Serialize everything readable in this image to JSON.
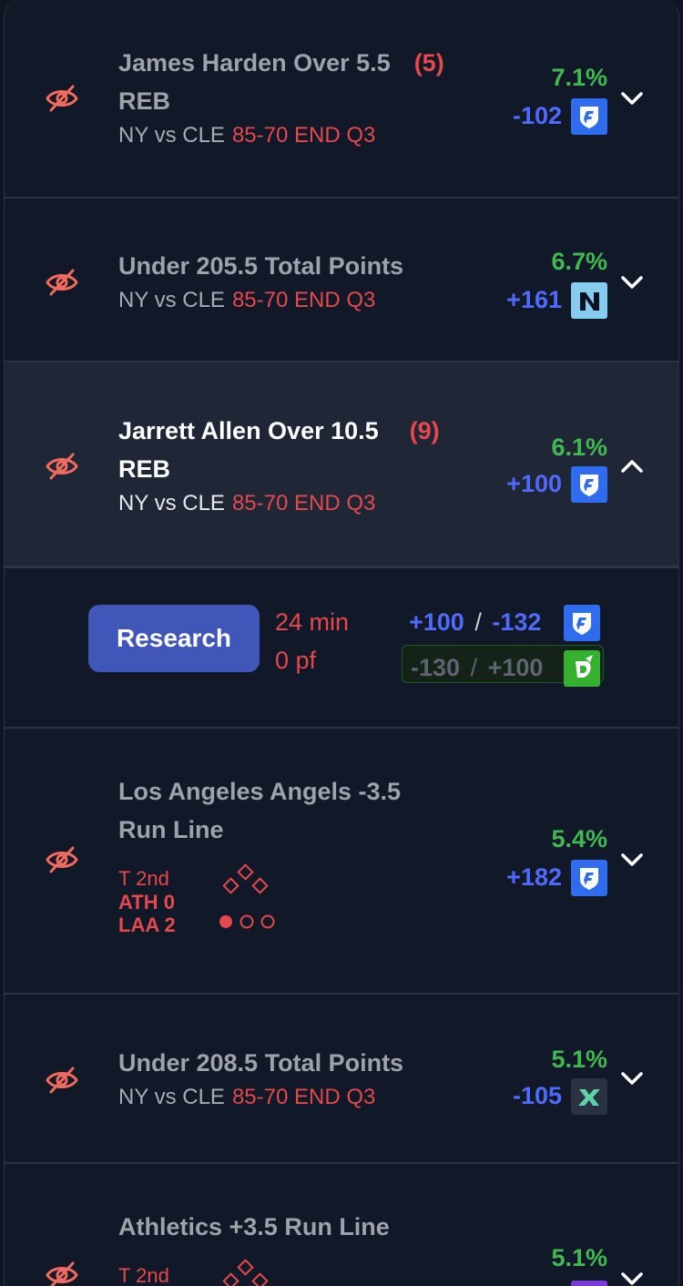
{
  "colors": {
    "green": "#3fb950",
    "blue": "#4f6bff",
    "red": "#e5484d",
    "button": "#4056b8"
  },
  "bets": [
    {
      "title": "James Harden Over 5.5",
      "title2": "REB",
      "count": "(5)",
      "teams": "NY vs CLE",
      "score": "85-70 END Q3",
      "pct": "7.1%",
      "odds": "-102",
      "book_icon": "fanduel-icon"
    },
    {
      "title": "Under 205.5 Total Points",
      "teams": "NY vs CLE",
      "score": "85-70 END Q3",
      "pct": "6.7%",
      "odds": "+161",
      "book_icon": "novig-icon"
    },
    {
      "title": "Jarrett Allen Over 10.5",
      "title2": "REB",
      "count": "(9)",
      "teams": "NY vs CLE",
      "score": "85-70 END Q3",
      "pct": "6.1%",
      "odds": "+100",
      "book_icon": "fanduel-icon",
      "expanded": true
    },
    {
      "title": "Los Angeles Angels -3.5",
      "title2": "Run Line",
      "inning": "T  2nd",
      "away": "ATH  0",
      "home": "LAA  2",
      "pct": "5.4%",
      "odds": "+182",
      "book_icon": "fanduel-icon"
    },
    {
      "title": "Under 208.5 Total Points",
      "teams": "NY vs CLE",
      "score": "85-70 END Q3",
      "pct": "5.1%",
      "odds": "-105",
      "book_icon": "fliff-icon"
    },
    {
      "title": "Athletics +3.5 Run Line",
      "inning": "T  2nd",
      "pct": "5.1%"
    }
  ],
  "detail": {
    "research_label": "Research",
    "minutes": "24 min",
    "fouls": "0 pf",
    "fd_over": "+100",
    "fd_sep": "/",
    "fd_under": "-132",
    "dk_over": "-130",
    "dk_sep": "/",
    "dk_under": "+100"
  }
}
